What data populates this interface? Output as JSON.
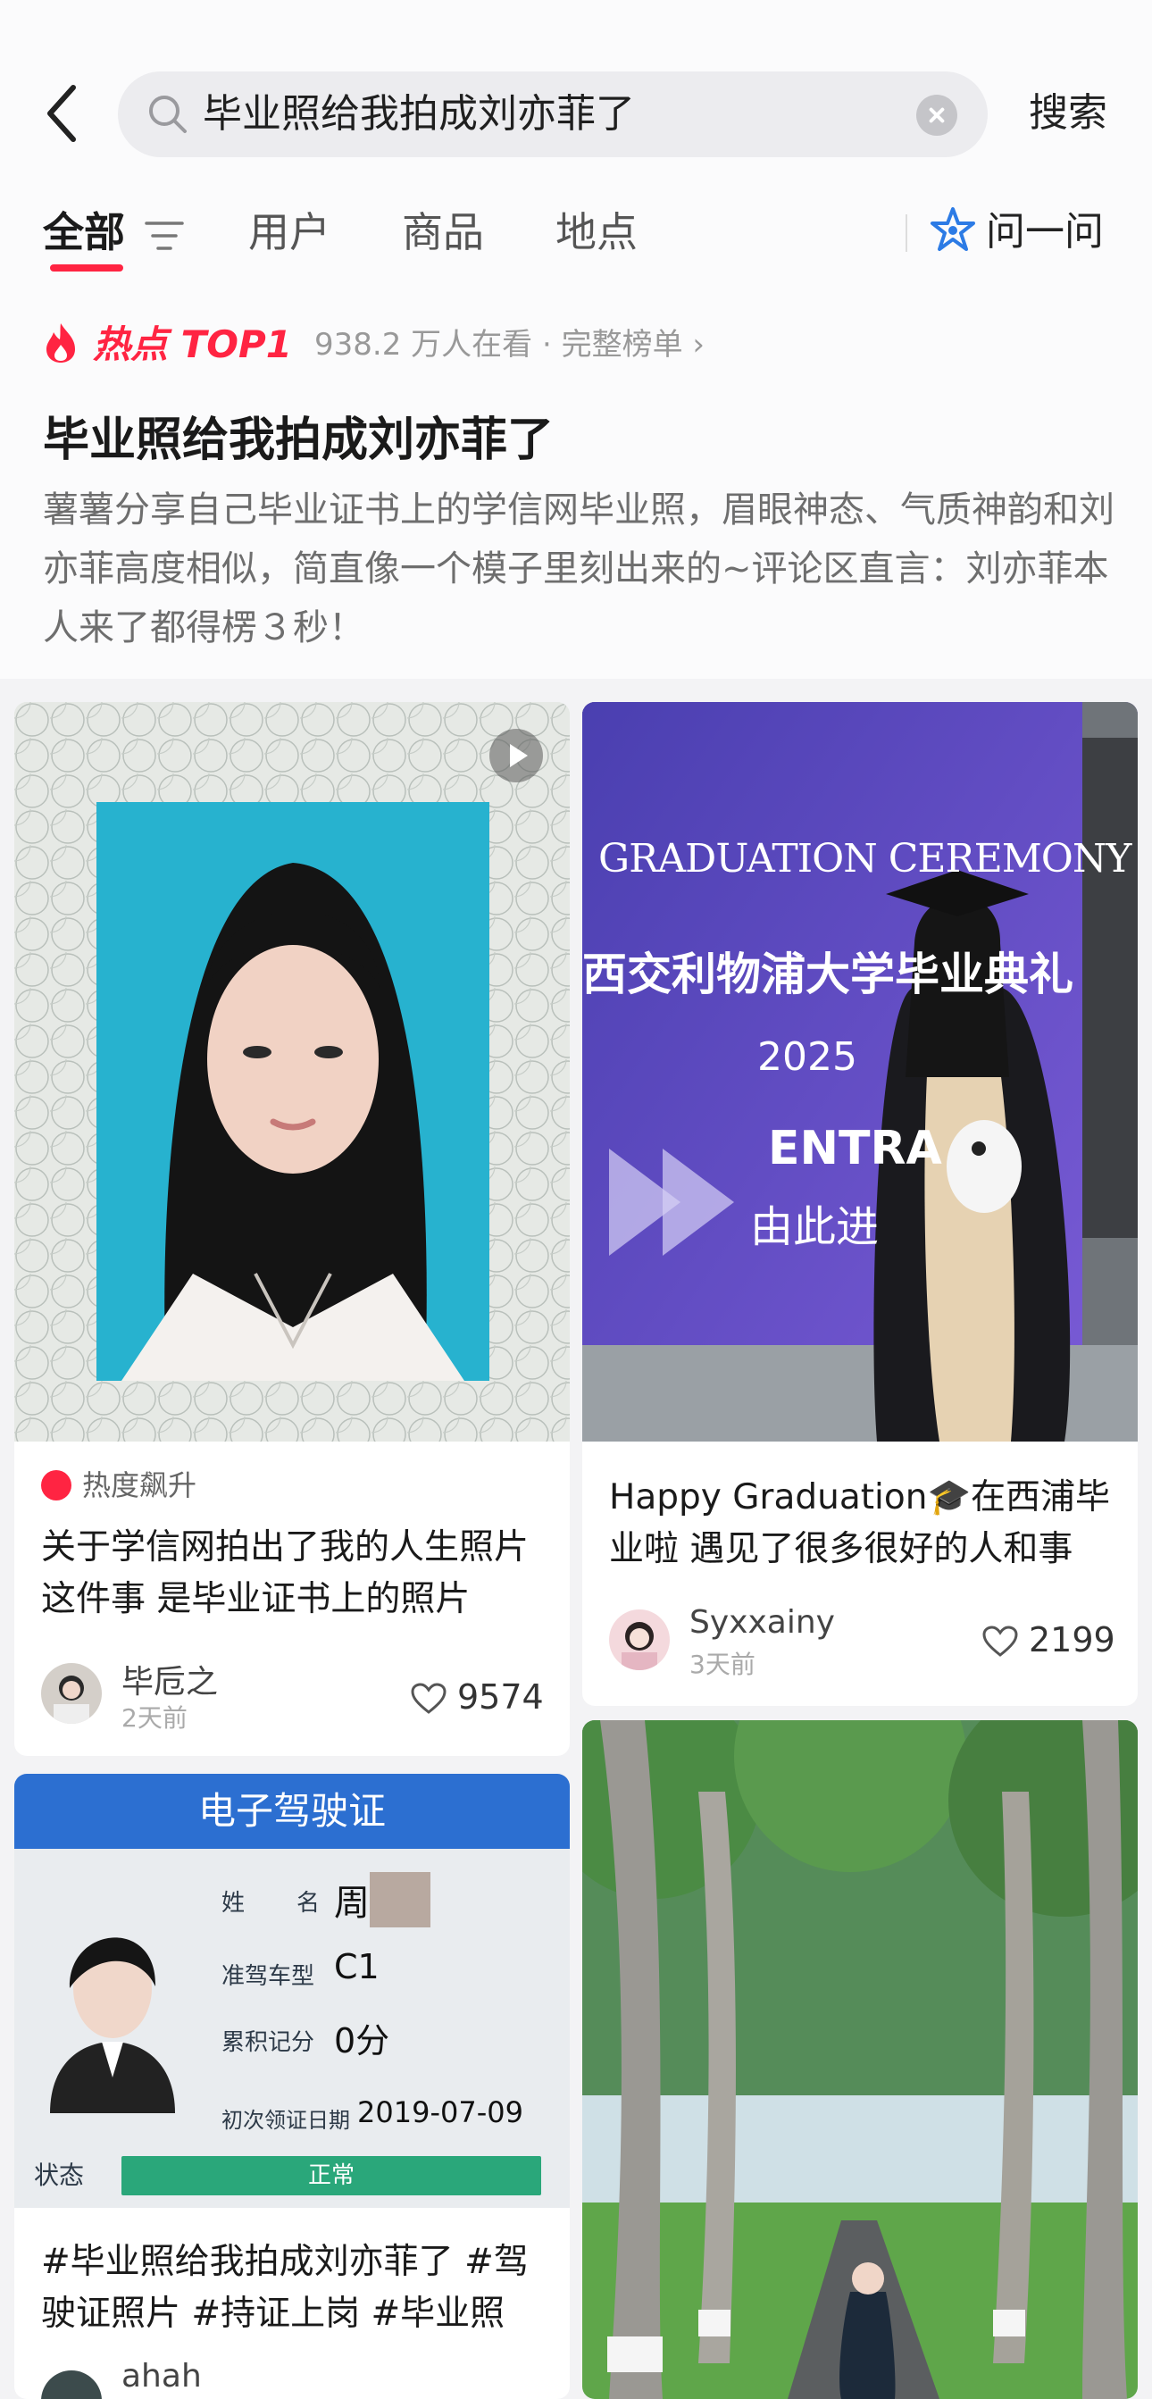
{
  "search": {
    "query": "毕业照给我拍成刘亦菲了",
    "submit_label": "搜索"
  },
  "tabs": [
    {
      "label": "全部",
      "active": true
    },
    {
      "label": "用户",
      "active": false
    },
    {
      "label": "商品",
      "active": false
    },
    {
      "label": "地点",
      "active": false
    }
  ],
  "ask_label": "问一问",
  "hot": {
    "badge": "热点 TOP1",
    "meta": "938.2 万人在看 · 完整榜单 ›",
    "title": "毕业照给我拍成刘亦菲了",
    "description": "薯薯分享自己毕业证书上的学信网毕业照，眉眼神态、气质神韵和刘亦菲高度相似，简直像一个模子里刻出来的~评论区直言：刘亦菲本人来了都得楞３秒！"
  },
  "cards": [
    {
      "tag": "热度飙升",
      "title": "关于学信网拍出了我的人生照片这件事 是毕业证书上的照片",
      "author": "毕卮之",
      "time": "2天前",
      "likes": "9574"
    },
    {
      "title": "Happy Graduation🎓在西浦毕业啦 遇见了很多很好的人和事",
      "author": "Syxxainy",
      "time": "3天前",
      "likes": "2199",
      "image_text": {
        "line1": "GRADUATION CEREMONY",
        "line2": "西交利物浦大学毕业典礼",
        "line3": "2025",
        "line4": "ENTRA",
        "line5": "由此进"
      }
    },
    {
      "title": "#毕业照给我拍成刘亦菲了 #驾驶证照片 #持证上岗 #毕业照",
      "author": "ahah",
      "license": {
        "header": "电子驾驶证",
        "name_label": "姓　　名",
        "name_value": "周",
        "class_label": "准驾车型",
        "class_value": "C1",
        "points_label": "累积记分",
        "points_value": "0分",
        "date_label": "初次领证日期",
        "date_value": "2019-07-09",
        "status_label": "状态",
        "status_value": "正常"
      }
    }
  ],
  "colors": {
    "accent": "#ff2442",
    "background": "#f3f3f5"
  }
}
